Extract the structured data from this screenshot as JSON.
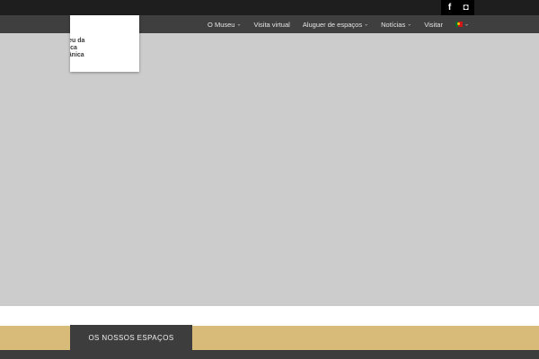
{
  "social": {
    "facebook": "f",
    "instagram": "◘"
  },
  "nav": {
    "items": [
      {
        "label": "O Museu",
        "chevron": "⌄"
      },
      {
        "label": "Visita virtual"
      },
      {
        "label": "Aluguer de espaços",
        "chevron": "⌄"
      },
      {
        "label": "Notícias",
        "chevron": "⌄"
      },
      {
        "label": "Visitar"
      }
    ],
    "language_chevron": "⌄"
  },
  "logo": {
    "line1": "useu da",
    "line2": "úsica",
    "line3": "ecânica"
  },
  "section": {
    "tab_label": "OS NOSSOS ESPAÇOS"
  },
  "colors": {
    "topbar": "#1e1e1e",
    "navbar": "#3f3f3f",
    "hero": "#cccccc",
    "band": "#d8bb78",
    "tab": "#3d3d3d"
  }
}
